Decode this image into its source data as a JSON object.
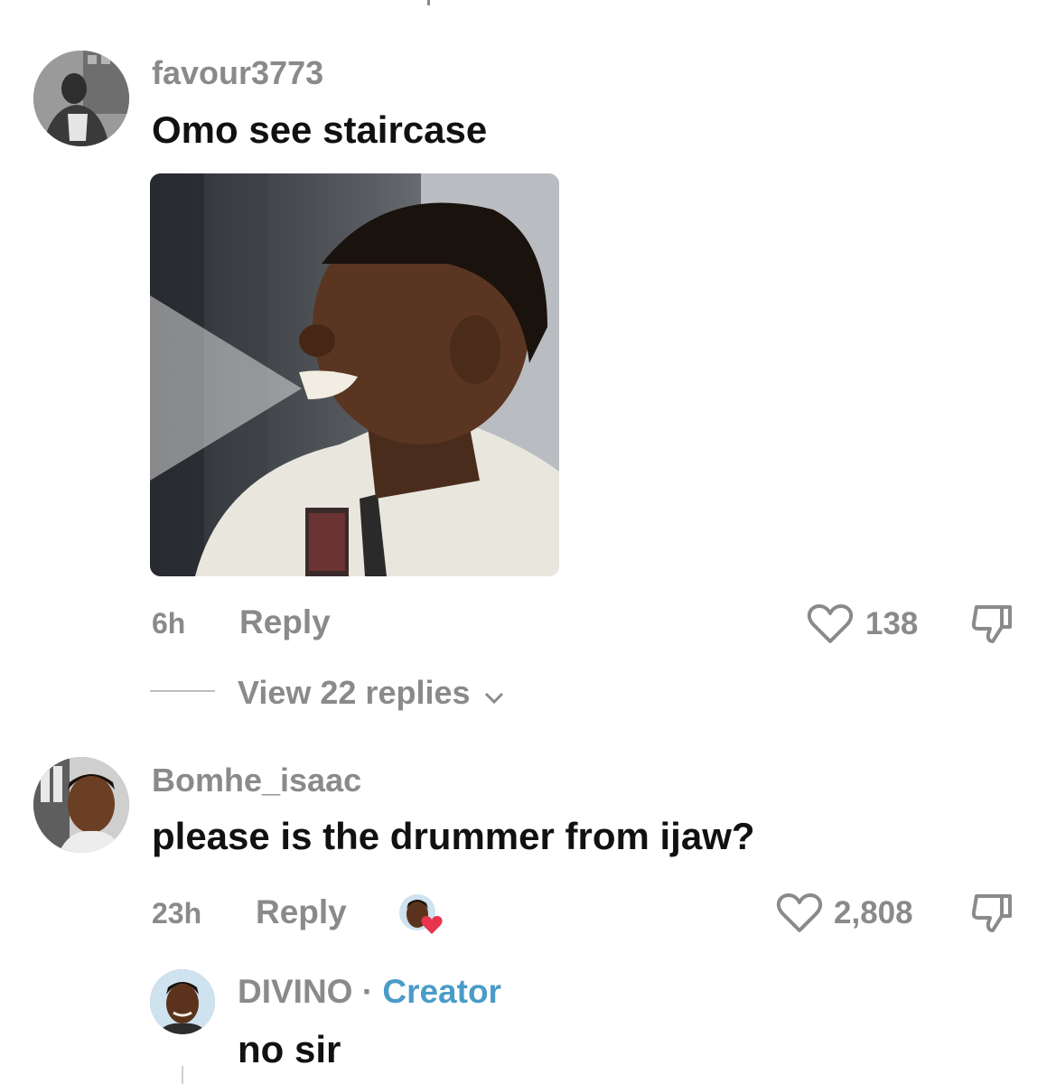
{
  "comments": [
    {
      "username": "favour3773",
      "text": "Omo see staircase",
      "time": "6h",
      "reply_label": "Reply",
      "likes": "138",
      "view_replies": "View 22 replies"
    },
    {
      "username": "Bomhe_isaac",
      "text": "please is the drummer from ijaw?",
      "time": "23h",
      "reply_label": "Reply",
      "likes": "2,808"
    }
  ],
  "reply": {
    "username": "DIVINO",
    "separator": " · ",
    "badge": "Creator",
    "text": "no sir"
  },
  "icons": {
    "like": "heart-outline-icon",
    "dislike": "thumbs-down-icon",
    "expand": "chevron-down-icon",
    "play": "play-icon",
    "creator_liked": "heart-filled-icon"
  },
  "colors": {
    "text_primary": "#111111",
    "text_secondary": "#8a8a8a",
    "creator_badge": "#4a9cc8",
    "liked_heart": "#e8344e"
  }
}
